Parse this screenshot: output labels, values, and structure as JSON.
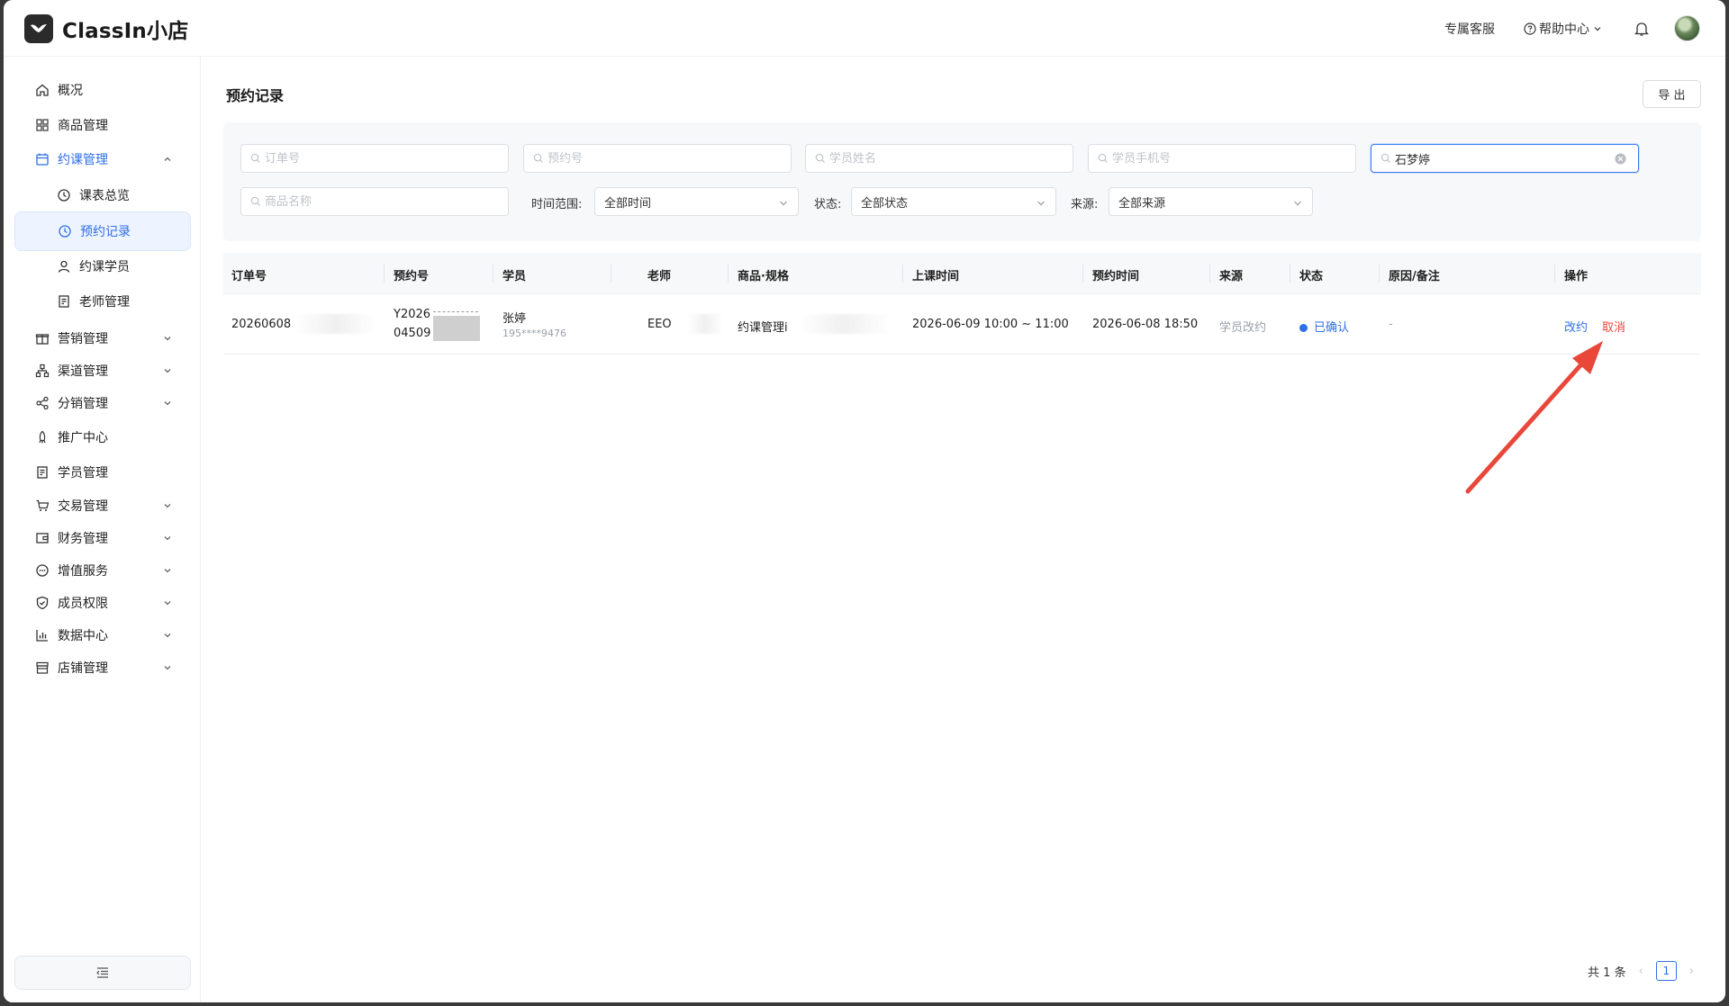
{
  "header": {
    "app_name": "ClassIn小店",
    "support_label": "专属客服",
    "help_label": "帮助中心",
    "help_icon": "question-circle-icon",
    "bell_icon": "bell-icon"
  },
  "sidebar": {
    "items": [
      {
        "label": "概况",
        "icon": "home-icon"
      },
      {
        "label": "商品管理",
        "icon": "grid-icon"
      },
      {
        "label": "约课管理",
        "icon": "calendar-icon",
        "expanded": true
      },
      {
        "label": "课表总览",
        "icon": "clock-icon"
      },
      {
        "label": "预约记录",
        "icon": "clock-icon",
        "active": true
      },
      {
        "label": "约课学员",
        "icon": "user-icon"
      },
      {
        "label": "老师管理",
        "icon": "badge-icon"
      },
      {
        "label": "营销管理",
        "icon": "gift-icon"
      },
      {
        "label": "渠道管理",
        "icon": "network-icon"
      },
      {
        "label": "分销管理",
        "icon": "share-icon"
      },
      {
        "label": "推广中心",
        "icon": "rocket-icon"
      },
      {
        "label": "学员管理",
        "icon": "document-icon"
      },
      {
        "label": "交易管理",
        "icon": "cart-icon"
      },
      {
        "label": "财务管理",
        "icon": "wallet-icon"
      },
      {
        "label": "增值服务",
        "icon": "chat-icon"
      },
      {
        "label": "成员权限",
        "icon": "shield-icon"
      },
      {
        "label": "数据中心",
        "icon": "bar-chart-icon"
      },
      {
        "label": "店铺管理",
        "icon": "store-icon"
      }
    ]
  },
  "main": {
    "title": "预约记录",
    "export_label": "导 出",
    "filters": {
      "order_no_placeholder": "订单号",
      "booking_no_placeholder": "预约号",
      "student_name_placeholder": "学员姓名",
      "student_phone_placeholder": "学员手机号",
      "teacher_value": "石梦婷",
      "product_placeholder": "商品名称",
      "time_range_label": "时间范围:",
      "time_range_value": "全部时间",
      "status_label": "状态:",
      "status_value": "全部状态",
      "source_label": "来源:",
      "source_value": "全部来源"
    },
    "table": {
      "columns": [
        "订单号",
        "预约号",
        "学员",
        "老师",
        "商品·规格",
        "上课时间",
        "预约时间",
        "来源",
        "状态",
        "原因/备注",
        "操作"
      ],
      "rows": [
        {
          "order_no": "20260608",
          "booking_no_line1": "Y2026",
          "booking_no_line2": "04509",
          "student_name": "张婷",
          "student_phone": "195****9476",
          "teacher": "EEO",
          "product": "约课管理i",
          "class_time": "2026-06-09 10:00 ~ 11:00",
          "booking_time": "2026-06-08 18:50",
          "source": "学员改约",
          "status": "已确认",
          "remark": "-",
          "action_reschedule": "改约",
          "action_cancel": "取消"
        }
      ]
    },
    "pagination": {
      "total_label": "共 1 条",
      "current_page": "1"
    }
  },
  "colors": {
    "accent": "#2f6fe8",
    "danger": "#e8473a",
    "annotation_arrow": "#e8473a"
  }
}
